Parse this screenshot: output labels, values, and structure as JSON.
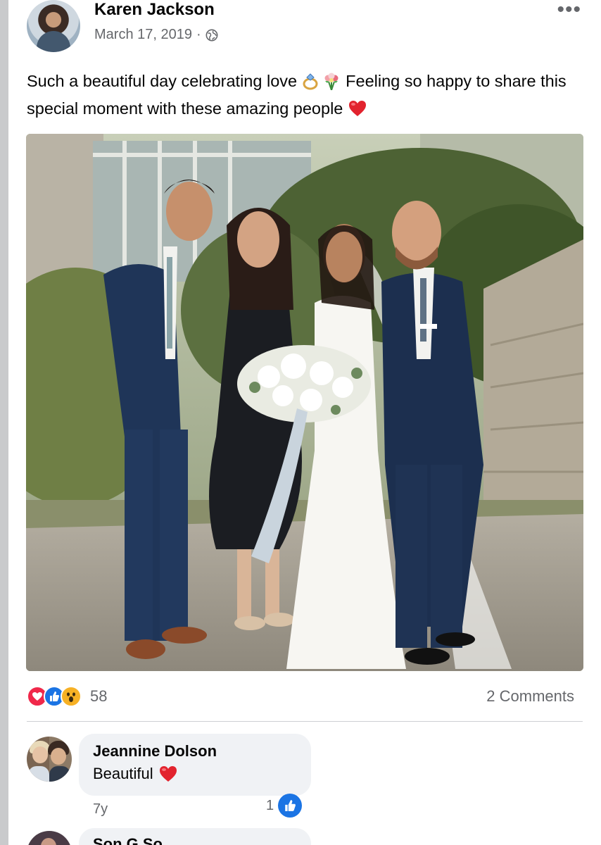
{
  "post": {
    "author": "Karen Jackson",
    "date": "March 17, 2019",
    "separator": "·",
    "privacy_icon": "globe-icon",
    "more_label": "•••",
    "text_part1": "Such a beautiful day celebrating love ",
    "text_part2": " Feeling so happy to share this special moment with these amazing people ",
    "emojis": [
      "ring-icon",
      "bouquet-icon",
      "heart-icon"
    ]
  },
  "reactions": {
    "types": [
      "love",
      "like",
      "wow"
    ],
    "count": "58",
    "comments_label": "2 Comments"
  },
  "comments": [
    {
      "name": "Jeannine Dolson",
      "text": "Beautiful",
      "emoji": "heart-icon",
      "time": "7y",
      "likes": "1"
    },
    {
      "name": "Son G So",
      "text": ""
    }
  ],
  "colors": {
    "accent": "#1b74e4",
    "love": "#f0284a",
    "wow": "#f7b125",
    "muted_text": "#65676b",
    "bubble": "#f0f2f5"
  }
}
